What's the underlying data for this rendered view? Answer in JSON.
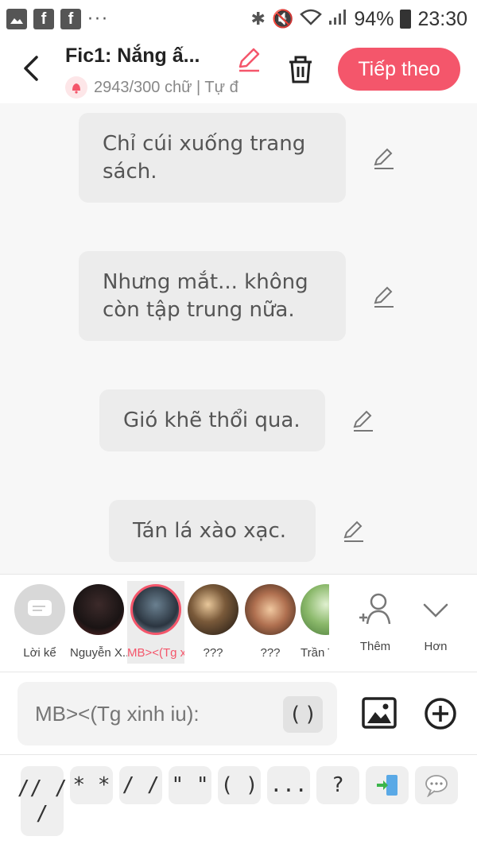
{
  "status_bar": {
    "left_icons": [
      "image-icon",
      "facebook-icon",
      "facebook-icon"
    ],
    "more": "···",
    "battery_pct": "94%",
    "time": "23:30"
  },
  "header": {
    "title": "Fic1: Nắng ấ...",
    "subtitle": "2943/300 chữ | Tự đ",
    "next_label": "Tiếp theo"
  },
  "messages": [
    {
      "text": "Chỉ cúi xuống trang sách."
    },
    {
      "text": "Nhưng mắt... không còn tập trung nữa."
    },
    {
      "text": "Gió khẽ thổi qua."
    },
    {
      "text": "Tán lá xào xạc."
    }
  ],
  "characters": [
    {
      "label": "Lời kể"
    },
    {
      "label": "Nguyễn X..."
    },
    {
      "label": "MB><(Tg x..."
    },
    {
      "label": "???"
    },
    {
      "label": "???"
    },
    {
      "label": "Trần T"
    }
  ],
  "char_actions": {
    "add_label": "Thêm",
    "more_label": "Hơn"
  },
  "input": {
    "placeholder": "MB><(Tg xinh iu):",
    "paren_chip": "( )"
  },
  "symbols": [
    "// /\n/",
    "* *",
    "/ /",
    "\" \"",
    "( )",
    "...",
    "?"
  ],
  "colors": {
    "accent": "#f4566b",
    "bubble": "#ececec",
    "background": "#f7f7f7"
  }
}
